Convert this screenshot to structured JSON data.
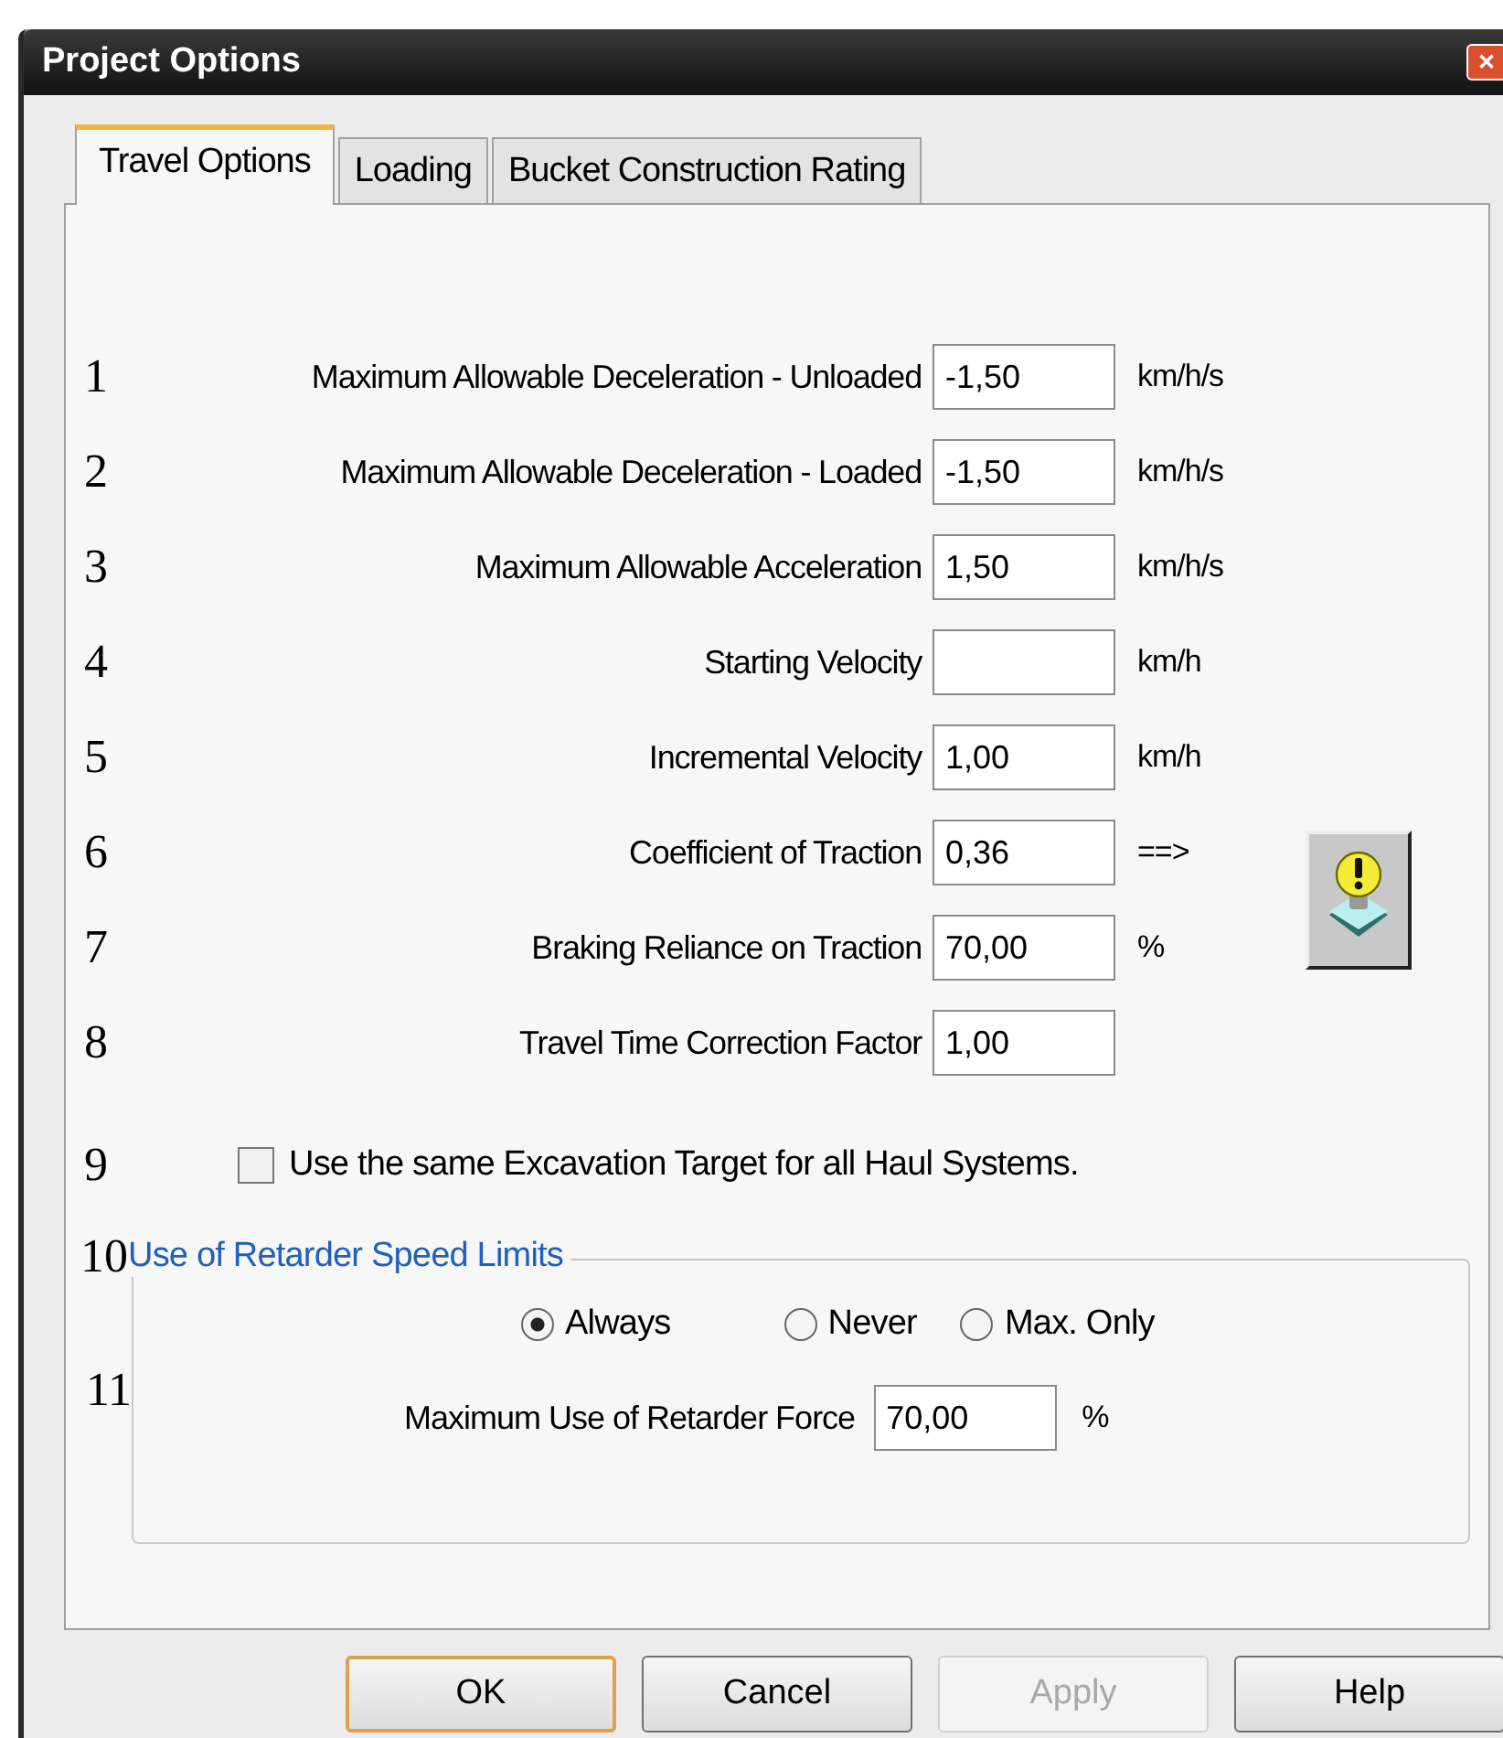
{
  "window": {
    "title": "Project Options",
    "close_icon": "✕"
  },
  "tabs": [
    {
      "label": "Travel Options",
      "selected": true
    },
    {
      "label": "Loading",
      "selected": false
    },
    {
      "label": "Bucket Construction Rating",
      "selected": false
    }
  ],
  "fields": [
    {
      "number": "1",
      "label": "Maximum Allowable Deceleration - Unloaded",
      "value": "-1,50",
      "unit": "km/h/s"
    },
    {
      "number": "2",
      "label": "Maximum Allowable Deceleration - Loaded",
      "value": "-1,50",
      "unit": "km/h/s"
    },
    {
      "number": "3",
      "label": "Maximum Allowable Acceleration",
      "value": "1,50",
      "unit": "km/h/s"
    },
    {
      "number": "4",
      "label": "Starting Velocity",
      "unit": "km/h"
    },
    {
      "number": "5",
      "label": "Incremental Velocity",
      "value": "1,00",
      "unit": "km/h"
    },
    {
      "number": "6",
      "label": "Coefficient of Traction",
      "value": "0,36",
      "unit": "==>"
    },
    {
      "number": "7",
      "label": "Braking Reliance on Traction",
      "value": "70,00",
      "unit": "%"
    },
    {
      "number": "8",
      "label": "Travel Time Correction Factor",
      "value": "1,00"
    }
  ],
  "checkbox": {
    "number": "9",
    "label": "Use the same Excavation Target for all Haul Systems.",
    "checked": false
  },
  "retarder_group": {
    "number": "10",
    "title": "Use of Retarder Speed Limits",
    "options": [
      {
        "label": "Always",
        "selected": true
      },
      {
        "label": "Never",
        "selected": false
      },
      {
        "label": "Max. Only",
        "selected": false
      }
    ],
    "force": {
      "number": "11",
      "label": "Maximum Use of Retarder Force",
      "value": "70,00",
      "unit": "%"
    }
  },
  "buttons": [
    {
      "label": "OK",
      "default": true,
      "disabled": false
    },
    {
      "label": "Cancel",
      "default": false,
      "disabled": false
    },
    {
      "label": "Apply",
      "default": false,
      "disabled": true
    },
    {
      "label": "Help",
      "default": false,
      "disabled": false
    }
  ]
}
